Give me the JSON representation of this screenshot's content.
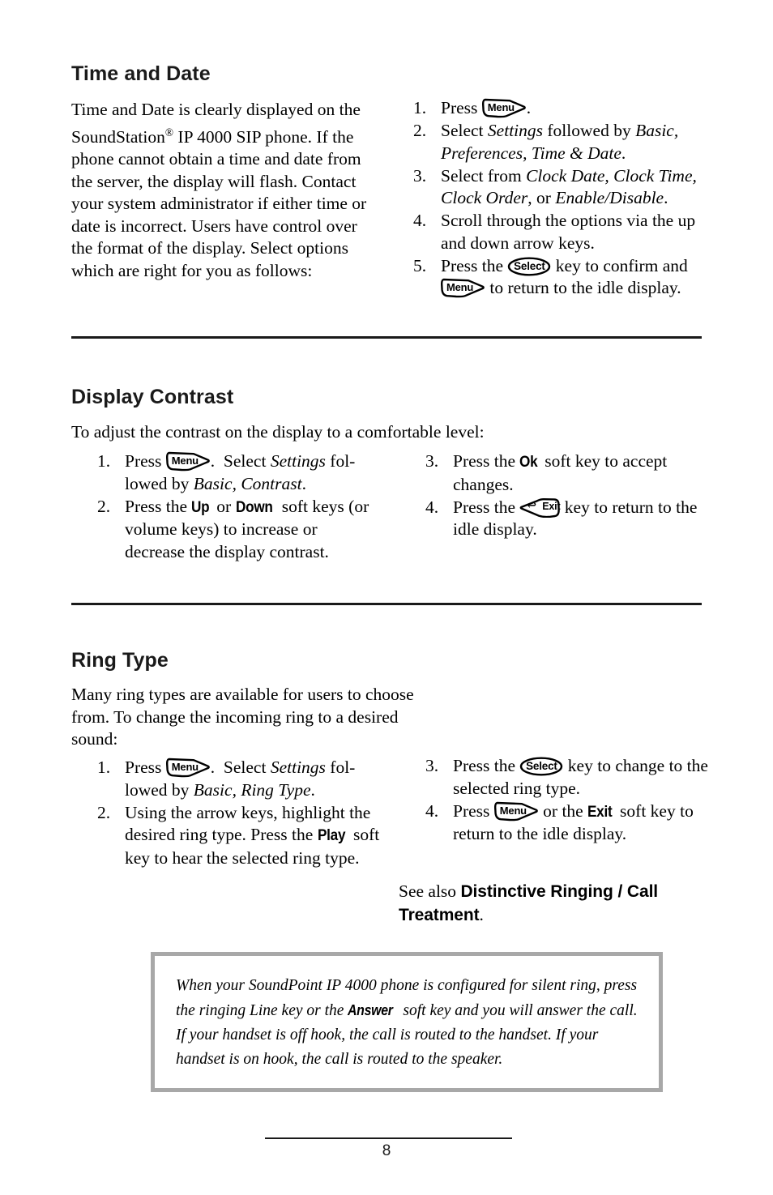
{
  "document": {
    "page_number": "8"
  },
  "sections": [
    {
      "id": "time-and-date",
      "heading": "Time and Date",
      "intro_parts": {
        "a": "Time and Date is clearly displayed on the SoundStation",
        "reg": "®",
        "b": " IP 4000 SIP phone.  If the phone cannot obtain a time and date from the server, the display will flash.  Contact your system administrator if either time or date is incorrect.  Users have control over the format of the display.  Select options which are right for you as follows:"
      },
      "steps": [
        {
          "num": "1.",
          "parts": [
            {
              "type": "text",
              "value": "Press "
            },
            {
              "type": "key",
              "value": "Menu"
            },
            {
              "type": "text",
              "value": "."
            }
          ]
        },
        {
          "num": "2.",
          "parts": [
            {
              "type": "text",
              "value": "Select "
            },
            {
              "type": "italic",
              "value": "Settings"
            },
            {
              "type": "text",
              "value": " followed by "
            },
            {
              "type": "italic",
              "value": "Basic, Preferences, Time & Date"
            },
            {
              "type": "text",
              "value": "."
            }
          ]
        },
        {
          "num": "3.",
          "parts": [
            {
              "type": "text",
              "value": "Select from "
            },
            {
              "type": "italic",
              "value": "Clock Date, Clock Time, Clock Order"
            },
            {
              "type": "text",
              "value": ", or "
            },
            {
              "type": "italic",
              "value": "Enable/Disable"
            },
            {
              "type": "text",
              "value": "."
            }
          ]
        },
        {
          "num": "4.",
          "parts": [
            {
              "type": "text",
              "value": "Scroll through the options via the up and down arrow keys."
            }
          ]
        },
        {
          "num": "5.",
          "parts": [
            {
              "type": "text",
              "value": "Press the "
            },
            {
              "type": "key",
              "value": "Select"
            },
            {
              "type": "text",
              "value": " key to confirm and "
            },
            {
              "type": "key",
              "value": "Menu"
            },
            {
              "type": "text",
              "value": " to return to the idle display."
            }
          ]
        }
      ]
    },
    {
      "id": "display-contrast",
      "heading": "Display Contrast",
      "intro": "To adjust the contrast on the display to a comfortable level:",
      "steps_left": [
        {
          "num": "1.",
          "parts": [
            {
              "type": "text",
              "value": "Press "
            },
            {
              "type": "key",
              "value": "Menu"
            },
            {
              "type": "text",
              "value": ".  Select "
            },
            {
              "type": "italic",
              "value": "Settings"
            },
            {
              "type": "text",
              "value": " fol-lowed by "
            },
            {
              "type": "italic",
              "value": "Basic, Contrast"
            },
            {
              "type": "text",
              "value": "."
            }
          ]
        },
        {
          "num": "2.",
          "parts": [
            {
              "type": "text",
              "value": "Press the "
            },
            {
              "type": "softkey",
              "value": "Up"
            },
            {
              "type": "text",
              "value": " or "
            },
            {
              "type": "softkey",
              "value": "Down"
            },
            {
              "type": "text",
              "value": " soft keys (or volume keys) to increase or decrease the display contrast."
            }
          ]
        }
      ],
      "steps_right": [
        {
          "num": "3.",
          "parts": [
            {
              "type": "text",
              "value": "Press the "
            },
            {
              "type": "softkey",
              "value": "Ok"
            },
            {
              "type": "text",
              "value": " soft key to accept changes."
            }
          ]
        },
        {
          "num": "4.",
          "parts": [
            {
              "type": "text",
              "value": "Press the "
            },
            {
              "type": "key",
              "value": "Exit"
            },
            {
              "type": "text",
              "value": " key to return to the idle display."
            }
          ]
        }
      ]
    },
    {
      "id": "ring-type",
      "heading": "Ring Type",
      "intro": "Many ring types are available for users to choose from.  To change the incoming ring to a desired sound:",
      "steps_left": [
        {
          "num": "1.",
          "parts": [
            {
              "type": "text",
              "value": "Press "
            },
            {
              "type": "key",
              "value": "Menu"
            },
            {
              "type": "text",
              "value": ".  Select "
            },
            {
              "type": "italic",
              "value": "Settings"
            },
            {
              "type": "text",
              "value": " fol-lowed by "
            },
            {
              "type": "italic",
              "value": "Basic, Ring Type"
            },
            {
              "type": "text",
              "value": "."
            }
          ]
        },
        {
          "num": "2.",
          "parts": [
            {
              "type": "text",
              "value": "Using the arrow keys, highlight the desired ring type.  Press the "
            },
            {
              "type": "softkey",
              "value": "Play"
            },
            {
              "type": "text",
              "value": " soft key to hear the selected ring type."
            }
          ]
        }
      ],
      "steps_right": [
        {
          "num": "3.",
          "parts": [
            {
              "type": "text",
              "value": "Press the "
            },
            {
              "type": "key",
              "value": "Select"
            },
            {
              "type": "text",
              "value": " key to change to the selected ring type."
            }
          ]
        },
        {
          "num": "4.",
          "parts": [
            {
              "type": "text",
              "value": "Press "
            },
            {
              "type": "key",
              "value": "Menu"
            },
            {
              "type": "text",
              "value": " or the "
            },
            {
              "type": "softkey",
              "value": "Exit"
            },
            {
              "type": "text",
              "value": " soft key to return to the idle display."
            }
          ]
        }
      ],
      "see_also": {
        "lead": "See also ",
        "reference": "Distinctive Ringing / Call Treatment",
        "trail": "."
      }
    }
  ],
  "note": {
    "parts": [
      {
        "type": "italic",
        "value": "When your SoundPoint IP 4000 phone is configured for silent ring, press the ringing Line key or the "
      },
      {
        "type": "softkey",
        "value": "Answer"
      },
      {
        "type": "italic",
        "value": " soft key and you will answer the call. If your handset is off hook, the call is routed to the handset. If your handset is on hook, the call is routed to the speaker."
      }
    ]
  },
  "icons": {
    "menu_key": "menu-key-icon",
    "select_key": "select-key-icon",
    "exit_key": "exit-key-icon",
    "exit_arrow": "↩"
  },
  "colors": {
    "text": "#000000",
    "heading": "#1a1a1a",
    "rule": "#1a1a1a",
    "note_border": "#a8a8a8"
  }
}
